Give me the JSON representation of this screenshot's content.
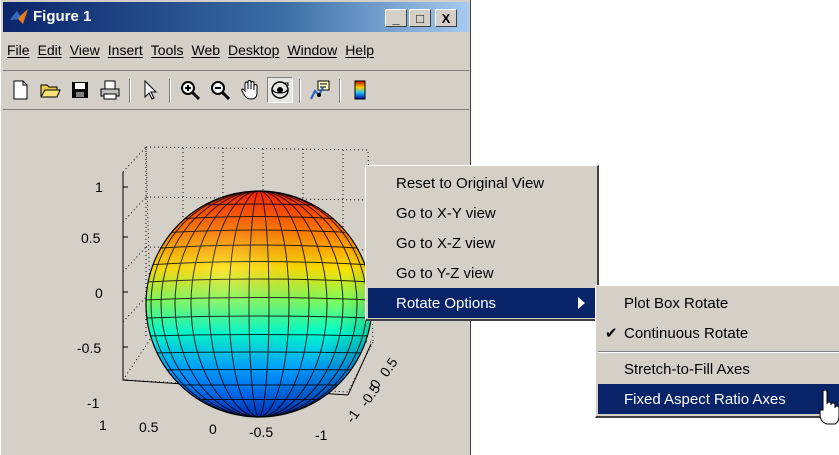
{
  "window": {
    "title": "Figure 1",
    "controls": {
      "minimize": "_",
      "maximize": "□",
      "close": "X"
    }
  },
  "menubar": [
    "File",
    "Edit",
    "View",
    "Insert",
    "Tools",
    "Web",
    "Desktop",
    "Window",
    "Help"
  ],
  "toolbar": {
    "icons": [
      "new-file-icon",
      "open-folder-icon",
      "save-disk-icon",
      "print-icon",
      "select-arrow-icon",
      "zoom-in-icon",
      "zoom-out-icon",
      "pan-hand-icon",
      "rotate-3d-icon",
      "data-cursor-icon",
      "colorbar-icon"
    ],
    "pressed": "rotate-3d-icon"
  },
  "plot": {
    "type": "sphere-surface",
    "z_ticks": [
      "1",
      "0.5",
      "0",
      "-0.5",
      "-1"
    ],
    "x_ticks": [
      "1",
      "0.5",
      "0",
      "-0.5",
      "-1"
    ],
    "y_ticks": [
      "-1",
      "-0.5",
      "0",
      "0.5"
    ],
    "colormap": "jet"
  },
  "context_menu": {
    "items": [
      "Reset to Original View",
      "Go to X-Y view",
      "Go to X-Z view",
      "Go to Y-Z view",
      "Rotate Options"
    ],
    "selected": "Rotate Options"
  },
  "submenu": {
    "items": [
      "Plot Box Rotate",
      "Continuous Rotate",
      "Stretch-to-Fill Axes",
      "Fixed Aspect Ratio Axes"
    ],
    "checked": "Continuous Rotate",
    "check_mark": "✔",
    "selected": "Fixed Aspect Ratio Axes"
  },
  "colors": {
    "selection": "#0a246a",
    "face": "#d4d0c8"
  }
}
